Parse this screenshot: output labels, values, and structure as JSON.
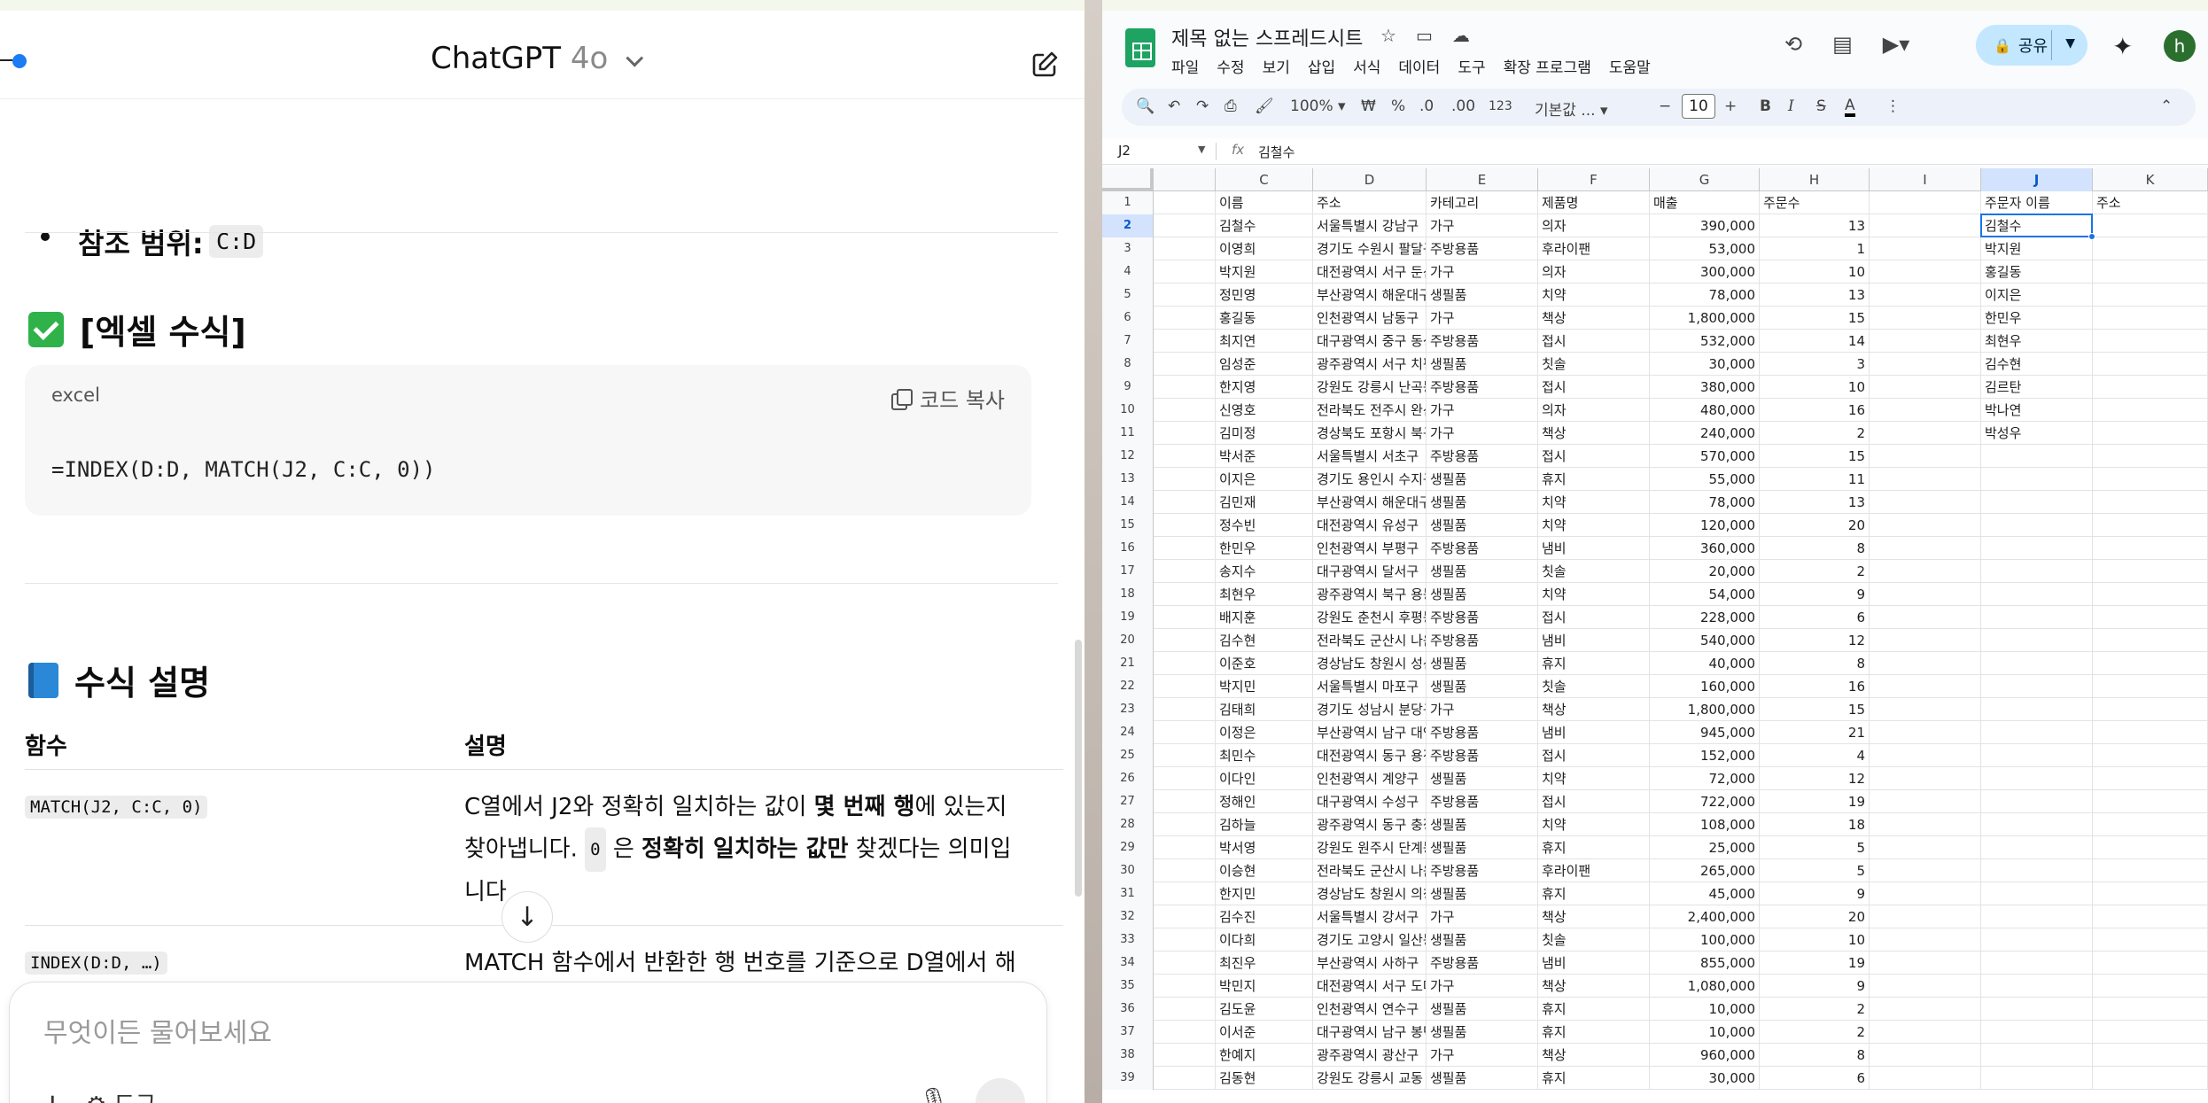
{
  "chatgpt": {
    "model_name": "ChatGPT",
    "model_version": "4o",
    "ref_label": "참조 범위:",
    "ref_code": "C:D",
    "section_formula_title": "[엑셀 수식]",
    "code_lang": "excel",
    "copy_label": "코드 복사",
    "code_text": "=INDEX(D:D, MATCH(J2, C:C, 0))",
    "section_explain_title": "수식 설명",
    "table_header_fn": "함수",
    "table_header_desc": "설명",
    "row1_fn": "MATCH(J2, C:C, 0)",
    "row1_desc_a": "C열에서 J2와 정확히 일치하는 값이 ",
    "row1_desc_bold_a": "몇 번째 행",
    "row1_desc_b": "에 있는지",
    "row1_desc_c": "찾아냅니다. ",
    "row1_desc_code": "0",
    "row1_desc_d": " 은 ",
    "row1_desc_bold_b": "정확히 일치하는 값만",
    "row1_desc_e": " 찾겠다는 의미입",
    "row1_desc_f": "니다",
    "row2_fn": "INDEX(D:D, …)",
    "row2_desc": "MATCH 함수에서 반환한 행 번호를 기준으로 D열에서 해",
    "composer_placeholder": "무엇이든 물어보세요",
    "composer_tools": "도구"
  },
  "sheets": {
    "doc_title": "제목 없는 스프레드시트",
    "menus": [
      "파일",
      "수정",
      "보기",
      "삽입",
      "서식",
      "데이터",
      "도구",
      "확장 프로그램",
      "도움말"
    ],
    "share_label": "공유",
    "avatar_letter": "h",
    "zoom": "100%",
    "currency": "₩",
    "percent": "%",
    "dec_minus": ".0",
    "dec_plus": ".00",
    "num_fmt": "123",
    "font_name": "기본값 ...",
    "font_size": "10",
    "bold": "B",
    "italic": "I",
    "strike": "S",
    "text_color": "A",
    "name_box": "J2",
    "fx": "fx",
    "formula_value": "김철수",
    "columns": [
      "C",
      "D",
      "E",
      "F",
      "G",
      "H",
      "I",
      "J",
      "K"
    ],
    "selected_column": "J",
    "selected_row": 2,
    "header_row": [
      "이름",
      "주소",
      "카테고리",
      "제품명",
      "매출",
      "주문수",
      "",
      "주문자 이름",
      "주소"
    ],
    "rows": [
      [
        "김철수",
        "서울특별시 강남구",
        "가구",
        "의자",
        "390,000",
        "13",
        "",
        "김철수",
        ""
      ],
      [
        "이영희",
        "경기도 수원시 팔달구",
        "주방용품",
        "후라이팬",
        "53,000",
        "1",
        "",
        "박지원",
        ""
      ],
      [
        "박지원",
        "대전광역시 서구 둔산동",
        "가구",
        "의자",
        "300,000",
        "10",
        "",
        "홍길동",
        ""
      ],
      [
        "정민영",
        "부산광역시 해운대구",
        "생필품",
        "치약",
        "78,000",
        "13",
        "",
        "이지은",
        ""
      ],
      [
        "홍길동",
        "인천광역시 남동구",
        "가구",
        "책상",
        "1,800,000",
        "15",
        "",
        "한민우",
        ""
      ],
      [
        "최지연",
        "대구광역시 중구 동성로",
        "주방용품",
        "접시",
        "532,000",
        "14",
        "",
        "최현우",
        ""
      ],
      [
        "임성준",
        "광주광역시 서구 치평동",
        "생필품",
        "칫솔",
        "30,000",
        "3",
        "",
        "김수현",
        ""
      ],
      [
        "한지영",
        "강원도 강릉시 난곡동",
        "주방용품",
        "접시",
        "380,000",
        "10",
        "",
        "김르탄",
        ""
      ],
      [
        "신영호",
        "전라북도 전주시 완산구",
        "가구",
        "의자",
        "480,000",
        "16",
        "",
        "박나연",
        ""
      ],
      [
        "김미정",
        "경상북도 포항시 북구",
        "가구",
        "책상",
        "240,000",
        "2",
        "",
        "박성우",
        ""
      ],
      [
        "박서준",
        "서울특별시 서초구",
        "주방용품",
        "접시",
        "570,000",
        "15",
        "",
        "",
        ""
      ],
      [
        "이지은",
        "경기도 용인시 수지구",
        "생필품",
        "휴지",
        "55,000",
        "11",
        "",
        "",
        ""
      ],
      [
        "김민재",
        "부산광역시 해운대구",
        "생필품",
        "치약",
        "78,000",
        "13",
        "",
        "",
        ""
      ],
      [
        "정수빈",
        "대전광역시 유성구",
        "생필품",
        "치약",
        "120,000",
        "20",
        "",
        "",
        ""
      ],
      [
        "한민우",
        "인천광역시 부평구",
        "주방용품",
        "냄비",
        "360,000",
        "8",
        "",
        "",
        ""
      ],
      [
        "송지수",
        "대구광역시 달서구",
        "생필품",
        "칫솔",
        "20,000",
        "2",
        "",
        "",
        ""
      ],
      [
        "최현우",
        "광주광역시 북구 용봉동",
        "생필품",
        "치약",
        "54,000",
        "9",
        "",
        "",
        ""
      ],
      [
        "배지훈",
        "강원도 춘천시 후평동",
        "주방용품",
        "접시",
        "228,000",
        "6",
        "",
        "",
        ""
      ],
      [
        "김수현",
        "전라북도 군산시 나운동",
        "주방용품",
        "냄비",
        "540,000",
        "12",
        "",
        "",
        ""
      ],
      [
        "이준호",
        "경상남도 창원시 성산구",
        "생필품",
        "휴지",
        "40,000",
        "8",
        "",
        "",
        ""
      ],
      [
        "박지민",
        "서울특별시 마포구",
        "생필품",
        "칫솔",
        "160,000",
        "16",
        "",
        "",
        ""
      ],
      [
        "김태희",
        "경기도 성남시 분당구",
        "가구",
        "책상",
        "1,800,000",
        "15",
        "",
        "",
        ""
      ],
      [
        "이정은",
        "부산광역시 남구 대연동",
        "주방용품",
        "냄비",
        "945,000",
        "21",
        "",
        "",
        ""
      ],
      [
        "최민수",
        "대전광역시 동구 용전동",
        "주방용품",
        "접시",
        "152,000",
        "4",
        "",
        "",
        ""
      ],
      [
        "이다인",
        "인천광역시 계양구",
        "생필품",
        "치약",
        "72,000",
        "12",
        "",
        "",
        ""
      ],
      [
        "정해인",
        "대구광역시 수성구",
        "주방용품",
        "접시",
        "722,000",
        "19",
        "",
        "",
        ""
      ],
      [
        "김하늘",
        "광주광역시 동구 충장로",
        "생필품",
        "치약",
        "108,000",
        "18",
        "",
        "",
        ""
      ],
      [
        "박서영",
        "강원도 원주시 단계동",
        "생필품",
        "휴지",
        "25,000",
        "5",
        "",
        "",
        ""
      ],
      [
        "이승현",
        "전라북도 군산시 나운동",
        "주방용품",
        "후라이팬",
        "265,000",
        "5",
        "",
        "",
        ""
      ],
      [
        "한지민",
        "경상남도 창원시 의창구",
        "생필품",
        "휴지",
        "45,000",
        "9",
        "",
        "",
        ""
      ],
      [
        "김수진",
        "서울특별시 강서구",
        "가구",
        "책상",
        "2,400,000",
        "20",
        "",
        "",
        ""
      ],
      [
        "이다희",
        "경기도 고양시 일산동구",
        "생필품",
        "칫솔",
        "100,000",
        "10",
        "",
        "",
        ""
      ],
      [
        "최진우",
        "부산광역시 사하구",
        "주방용품",
        "냄비",
        "855,000",
        "19",
        "",
        "",
        ""
      ],
      [
        "박민지",
        "대전광역시 서구 도마동",
        "가구",
        "책상",
        "1,080,000",
        "9",
        "",
        "",
        ""
      ],
      [
        "김도윤",
        "인천광역시 연수구",
        "생필품",
        "휴지",
        "10,000",
        "2",
        "",
        "",
        ""
      ],
      [
        "이서준",
        "대구광역시 남구 봉덕동",
        "생필품",
        "휴지",
        "10,000",
        "2",
        "",
        "",
        ""
      ],
      [
        "한예지",
        "광주광역시 광산구",
        "가구",
        "책상",
        "960,000",
        "8",
        "",
        "",
        ""
      ],
      [
        "김동현",
        "강원도 강릉시 교동",
        "생필품",
        "휴지",
        "30,000",
        "6",
        "",
        "",
        ""
      ]
    ]
  }
}
